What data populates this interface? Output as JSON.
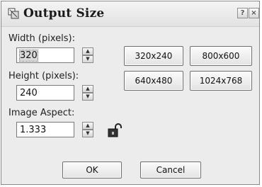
{
  "dialog": {
    "title": "Output Size",
    "help_label": "?",
    "close_label": "×"
  },
  "width": {
    "label": "Width (pixels):",
    "value": "320"
  },
  "height": {
    "label": "Height (pixels):",
    "value": "240"
  },
  "aspect": {
    "label": "Image Aspect:",
    "value": "1.333"
  },
  "presets": [
    "320x240",
    "800x600",
    "640x480",
    "1024x768"
  ],
  "buttons": {
    "ok": "OK",
    "cancel": "Cancel"
  },
  "icons": {
    "app": "output-size-icon",
    "lock": "padlock-icon",
    "spin_up": "arrow-up-icon",
    "spin_down": "arrow-down-icon"
  }
}
